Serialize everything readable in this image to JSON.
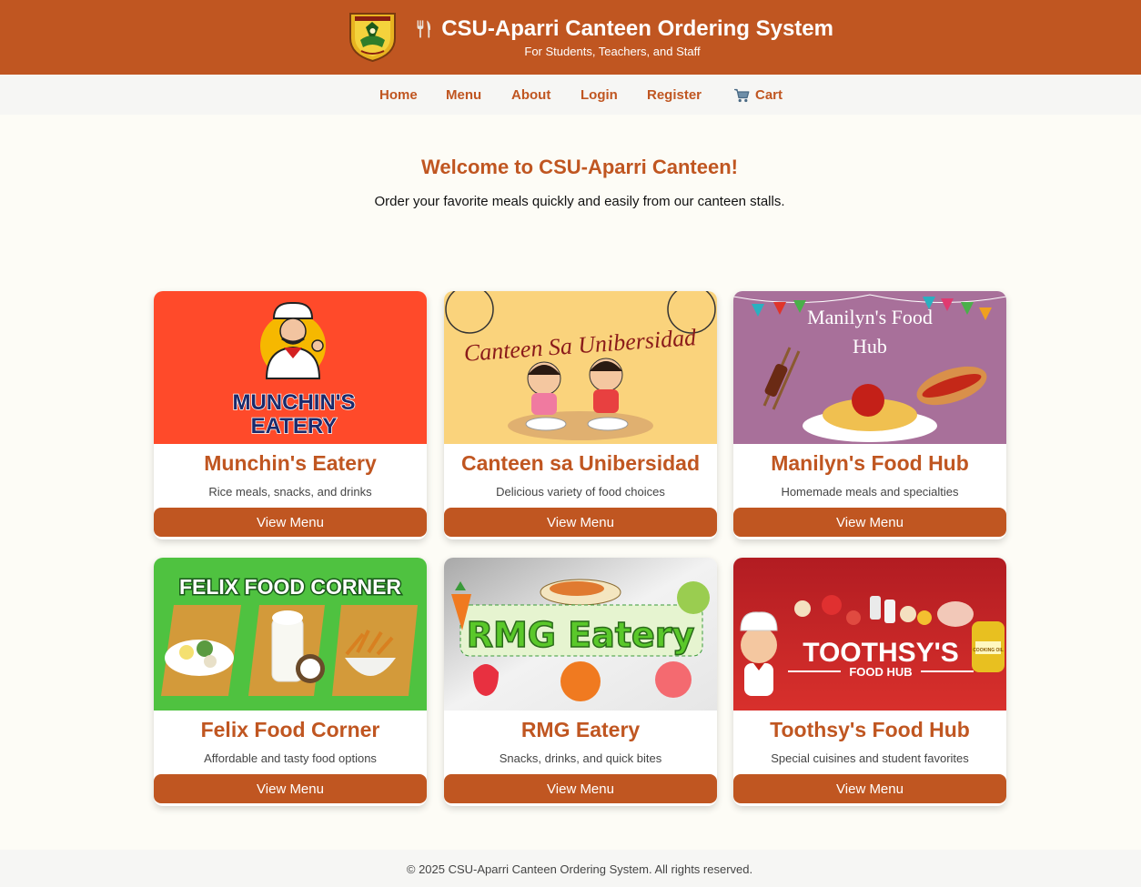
{
  "header": {
    "title": "CSU-Aparri Canteen Ordering System",
    "subtitle": "For Students, Teachers, and Staff",
    "logo_icon": "university-seal",
    "title_icon": "fork-knife-icon"
  },
  "nav": {
    "items": [
      {
        "label": "Home"
      },
      {
        "label": "Menu"
      },
      {
        "label": "About"
      },
      {
        "label": "Login"
      },
      {
        "label": "Register"
      },
      {
        "label": "Cart",
        "icon": "cart-icon"
      }
    ]
  },
  "hero": {
    "title": "Welcome to CSU-Aparri Canteen!",
    "text": "Order your favorite meals quickly and easily from our canteen stalls."
  },
  "stalls": [
    {
      "name": "Munchin's Eatery",
      "description": "Rice meals, snacks, and drinks",
      "button": "View Menu",
      "banner_text": [
        "MUNCHIN'S",
        "EATERY"
      ]
    },
    {
      "name": "Canteen sa Unibersidad",
      "description": "Delicious variety of food choices",
      "button": "View Menu",
      "banner_text": [
        "Canteen Sa Unibersidad"
      ]
    },
    {
      "name": "Manilyn's Food Hub",
      "description": "Homemade meals and specialties",
      "button": "View Menu",
      "banner_text": [
        "Manilyn's Food",
        "Hub"
      ]
    },
    {
      "name": "Felix Food Corner",
      "description": "Affordable and tasty food options",
      "button": "View Menu",
      "banner_text": [
        "FELIX FOOD CORNER"
      ]
    },
    {
      "name": "RMG Eatery",
      "description": "Snacks, drinks, and quick bites",
      "button": "View Menu",
      "banner_text": [
        "RMG Eatery"
      ]
    },
    {
      "name": "Toothsy's Food Hub",
      "description": "Special cuisines and student favorites",
      "button": "View Menu",
      "banner_text": [
        "TOOTHSY'S",
        "FOOD HUB",
        "COOKING OIL"
      ]
    }
  ],
  "footer": {
    "text": "© 2025 CSU-Aparri Canteen Ordering System. All rights reserved."
  },
  "colors": {
    "brand": "#c05621",
    "page_bg": "#fdfcf6",
    "nav_bg": "#f6f6f4"
  }
}
